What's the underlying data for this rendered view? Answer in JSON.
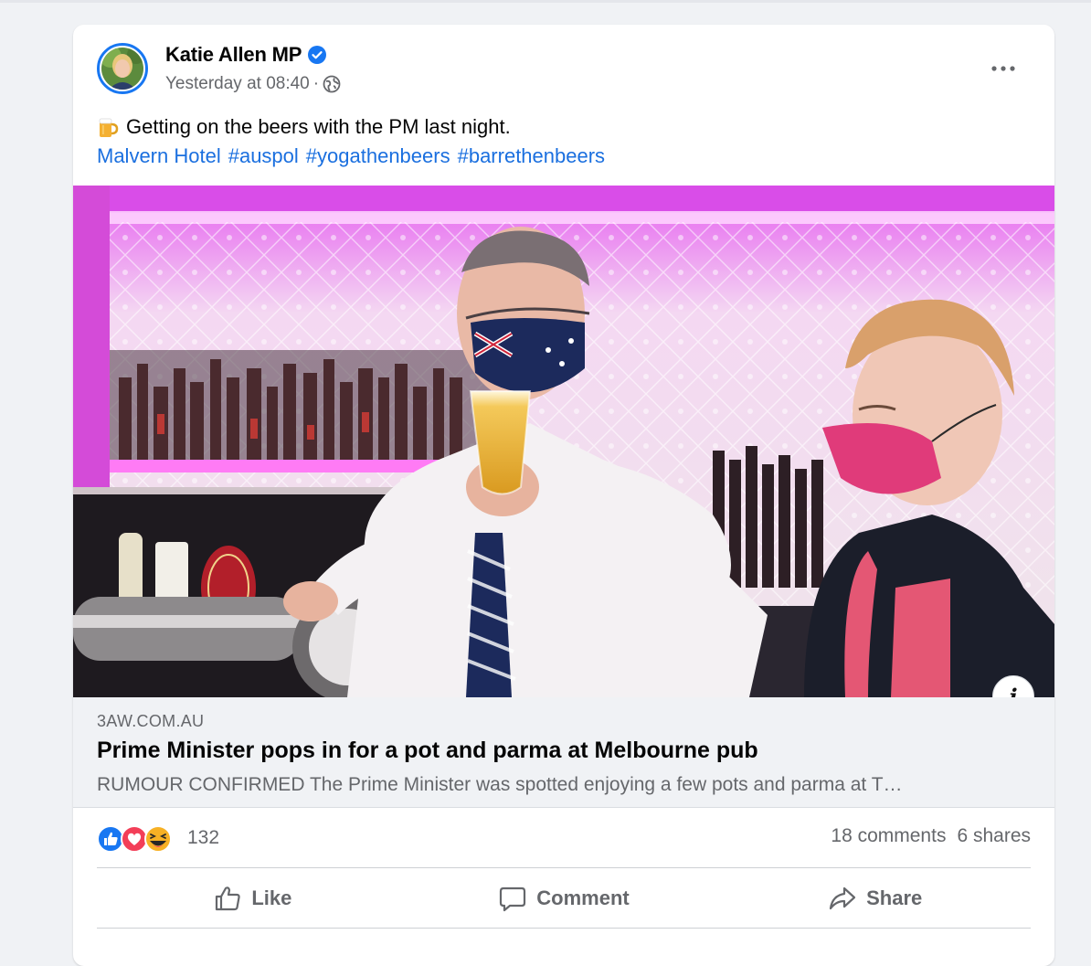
{
  "post": {
    "author": "Katie Allen MP",
    "timestamp": "Yesterday at 08:40",
    "separator": "·",
    "audience_icon": "globe-icon",
    "verified_icon": "verified-badge-icon",
    "more_icon": "more-options-icon",
    "text_line1": "Getting on the beers with the PM last night.",
    "emoji_icon": "beer-mug-icon",
    "links": [
      "Malvern Hotel",
      "#auspol",
      "#yogathenbeers",
      "#barrethenbeers"
    ]
  },
  "link_preview": {
    "domain": "3AW.COM.AU",
    "title": "Prime Minister pops in for a pot and parma at Melbourne pub",
    "description": "RUMOUR CONFIRMED The Prime Minister was spotted enjoying a few pots and parma at T…",
    "info_icon": "info-icon"
  },
  "engagement": {
    "reaction_icons": [
      "like-reaction-icon",
      "love-reaction-icon",
      "haha-reaction-icon"
    ],
    "reaction_count": "132",
    "comments": "18 comments",
    "shares": "6 shares"
  },
  "actions": {
    "like": "Like",
    "comment": "Comment",
    "share": "Share"
  },
  "colors": {
    "link_blue": "#1a6fdf",
    "brand_blue": "#1877f2",
    "muted_text": "#65676b",
    "photo_pink": "#e24ff2"
  }
}
